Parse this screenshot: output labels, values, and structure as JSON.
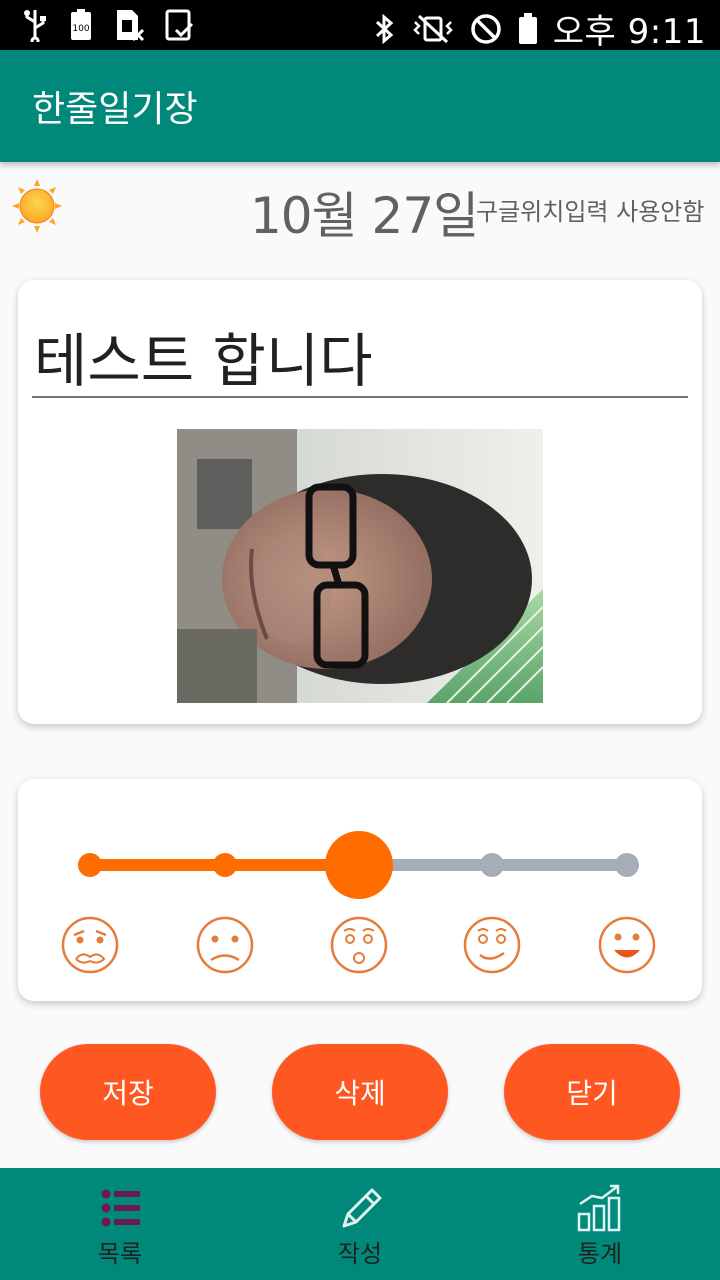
{
  "status_bar": {
    "time": "오후 9:11",
    "battery_level": "100",
    "left_icons": [
      "usb-icon",
      "battery-full-icon",
      "sim-off-icon",
      "screenshot-icon"
    ],
    "right_icons": [
      "bluetooth-icon",
      "vibrate-mute-icon",
      "do-not-disturb-icon",
      "battery-icon"
    ]
  },
  "app_bar": {
    "title": "한줄일기장"
  },
  "entry": {
    "weather": "sunny",
    "date": "10월 27일",
    "location": "구글위치입력 사용안함",
    "title": "테스트 합니다",
    "photo": "selfie-photo"
  },
  "mood": {
    "levels": 5,
    "selected_index": 2,
    "faces": [
      "very-sad-face-icon",
      "sad-face-icon",
      "surprised-face-icon",
      "smirk-face-icon",
      "happy-face-icon"
    ],
    "colors": {
      "active": "#ff6d00",
      "inactive": "#a7adb6",
      "face": "#e57c3a"
    }
  },
  "actions": {
    "save": "저장",
    "delete": "삭제",
    "close": "닫기"
  },
  "bottom_nav": [
    {
      "label": "목록",
      "icon": "list-icon",
      "active": true
    },
    {
      "label": "작성",
      "icon": "pencil-icon",
      "active": false
    },
    {
      "label": "통계",
      "icon": "bar-chart-icon",
      "active": false
    }
  ],
  "colors": {
    "primary": "#00897b",
    "accent": "#ff5722",
    "nav_active_icon": "#6a1b4d"
  }
}
